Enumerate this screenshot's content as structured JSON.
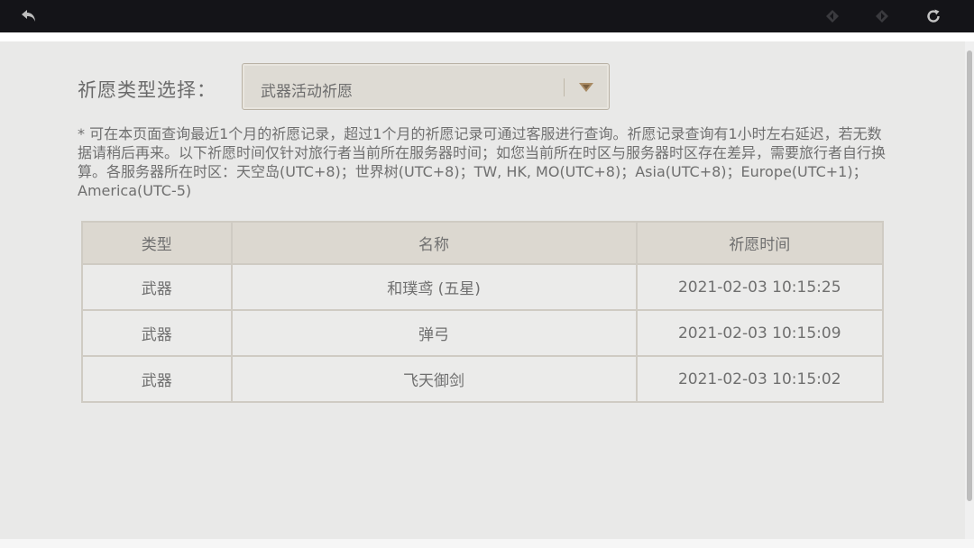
{
  "toolbar": {
    "back_icon": "back-arrow-icon",
    "prev_icon": "diamond-left-icon",
    "next_icon": "diamond-right-icon",
    "refresh_icon": "refresh-icon"
  },
  "filter": {
    "label": "祈愿类型选择：",
    "selected": "武器活动祈愿"
  },
  "notice": "* 可在本页面查询最近1个月的祈愿记录，超过1个月的祈愿记录可通过客服进行查询。祈愿记录查询有1小时左右延迟，若无数据请稍后再来。以下祈愿时间仅针对旅行者当前所在服务器时间；如您当前所在时区与服务器时区存在差异，需要旅行者自行换算。各服务器所在时区：天空岛(UTC+8)；世界树(UTC+8)；TW, HK, MO(UTC+8)；Asia(UTC+8)；Europe(UTC+1)；America(UTC-5)",
  "table": {
    "headers": [
      "类型",
      "名称",
      "祈愿时间"
    ],
    "rows": [
      {
        "type": "武器",
        "name": "和璞鸢 (五星)",
        "time": "2021-02-03 10:15:25",
        "rarity": "five-star"
      },
      {
        "type": "武器",
        "name": "弹弓",
        "time": "2021-02-03 10:15:09",
        "rarity": "normal"
      },
      {
        "type": "武器",
        "name": "飞天御剑",
        "time": "2021-02-03 10:15:02",
        "rarity": "normal"
      }
    ]
  },
  "colors": {
    "topbar": "#141418",
    "five_star": "#c46e2a",
    "text": "#6f6f6f"
  }
}
